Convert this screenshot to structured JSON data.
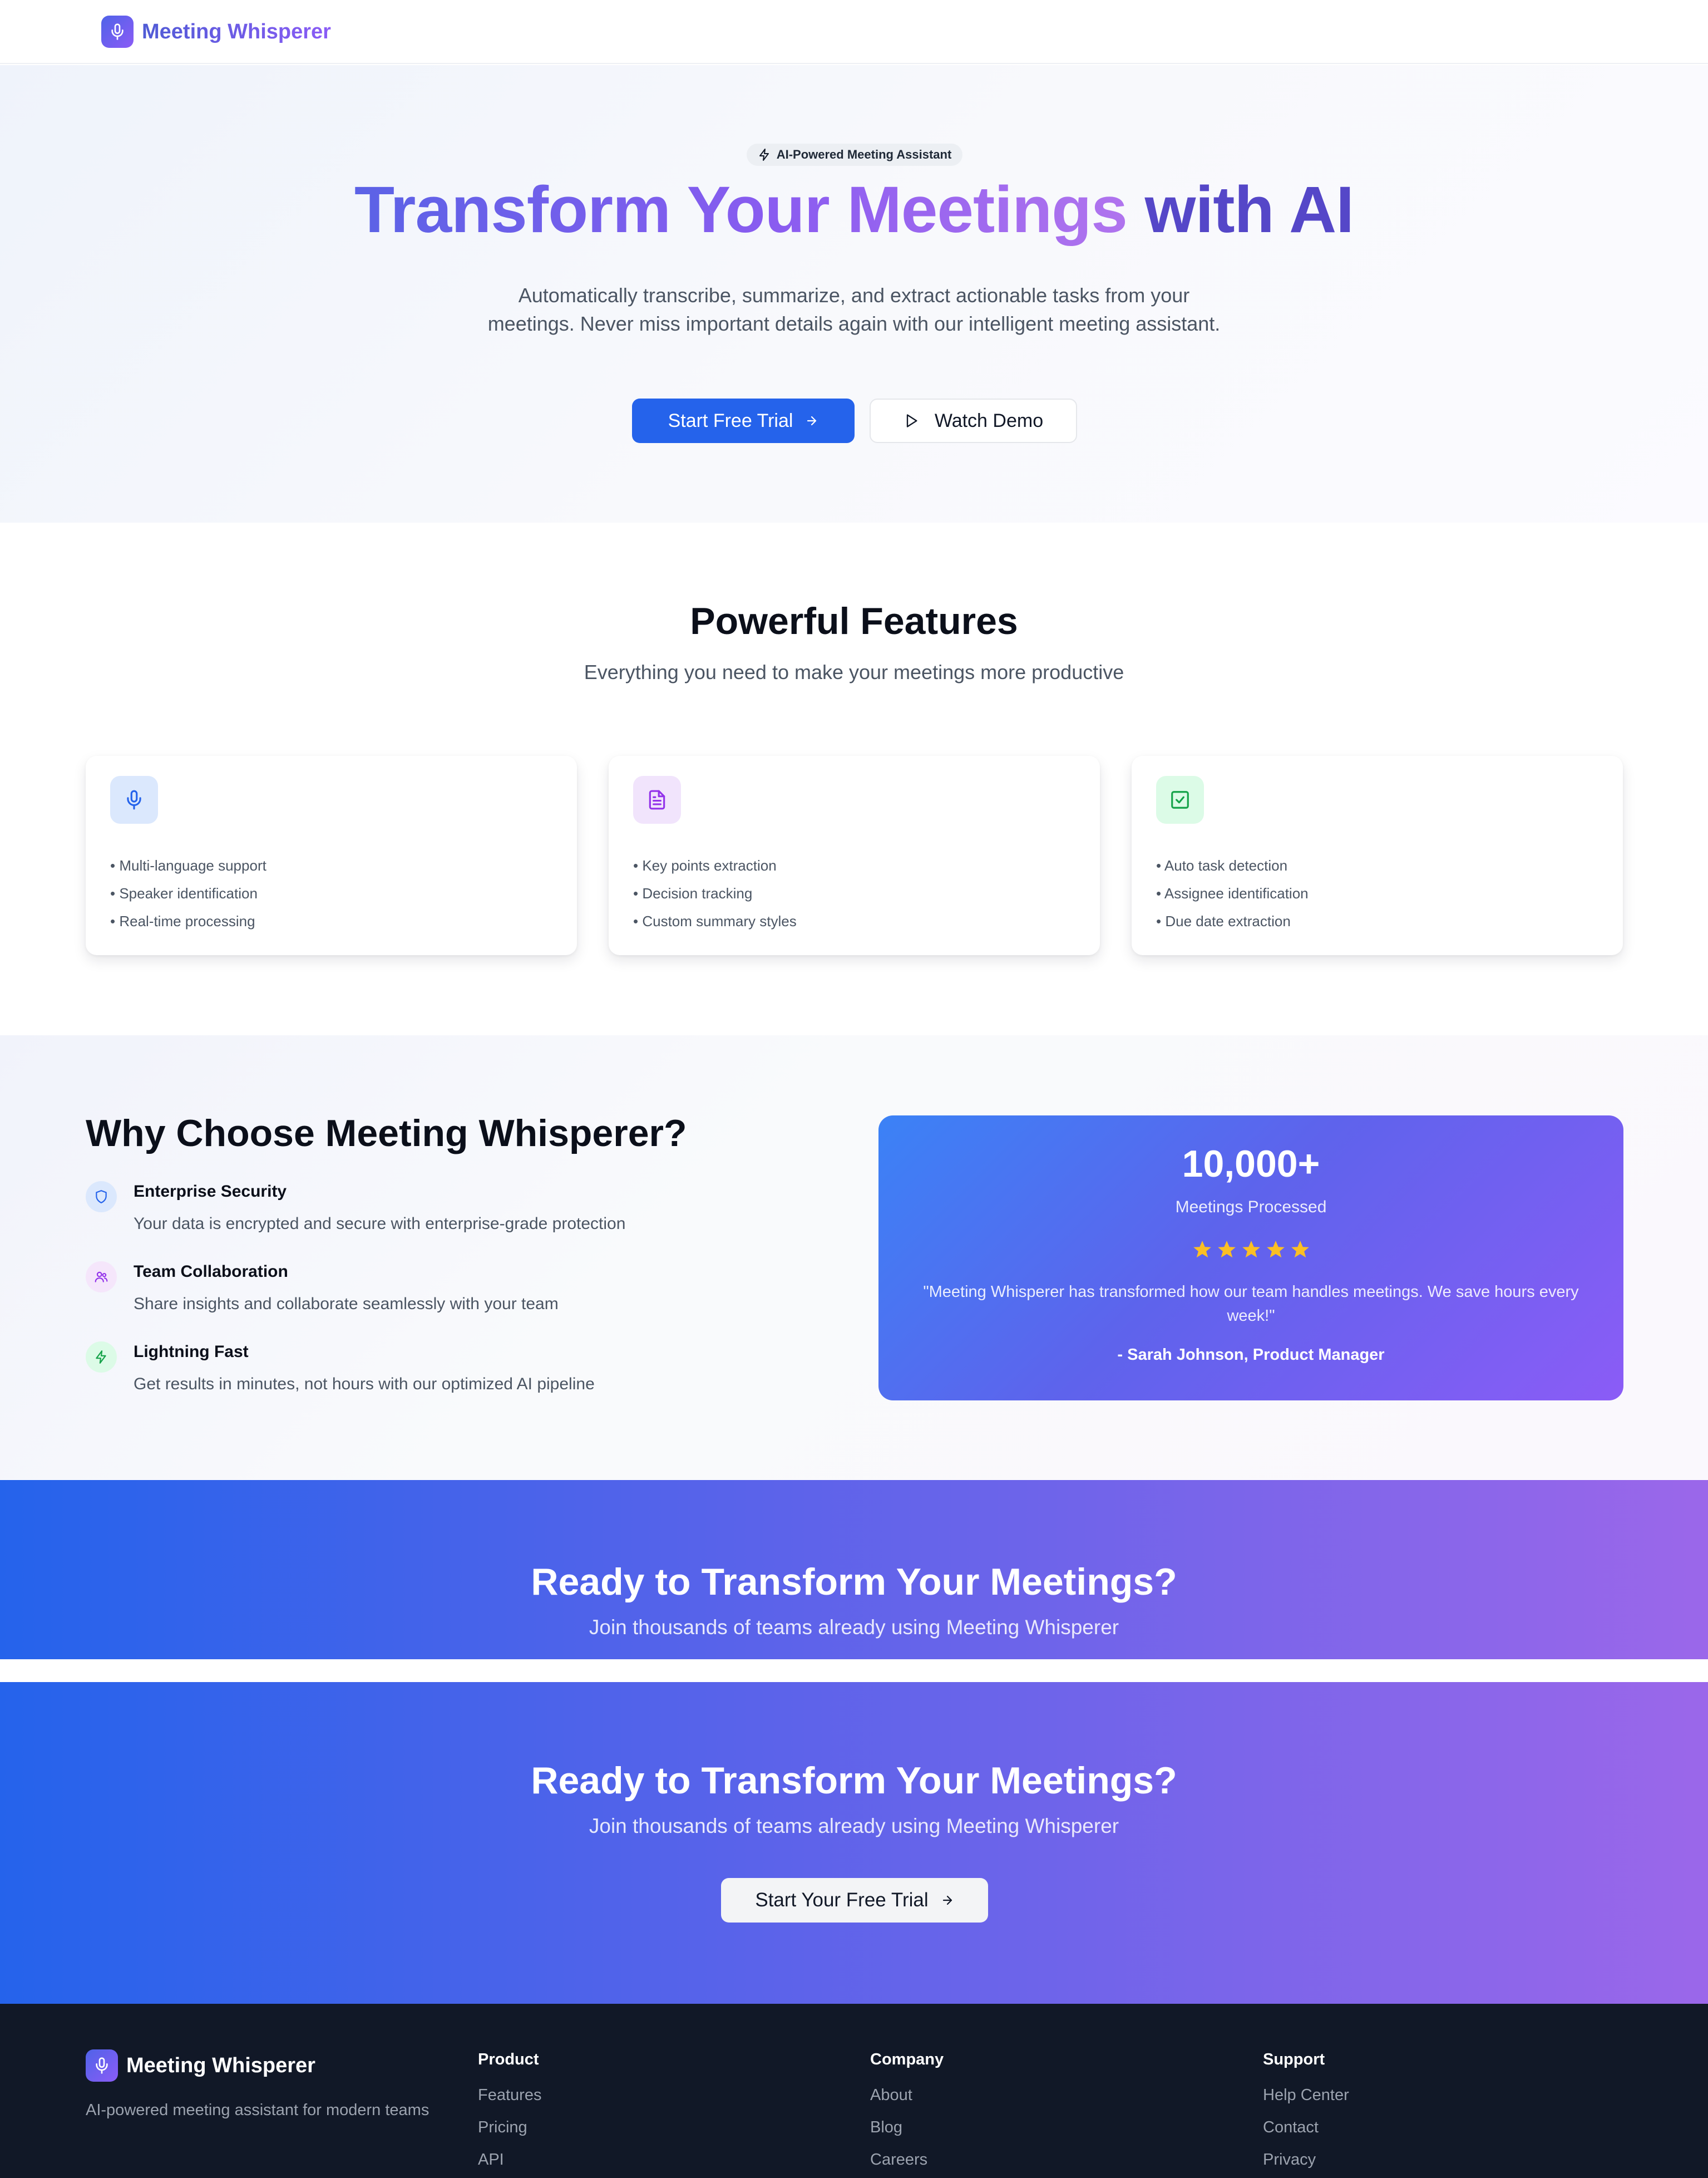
{
  "nav": {
    "brand": "Meeting Whisperer"
  },
  "hero": {
    "badge": "AI-Powered Meeting Assistant",
    "title_part1": "Transform Your Meetings",
    "title_part2": "with AI",
    "subtitle": "Automatically transcribe, summarize, and extract actionable tasks from your meetings. Never miss important details again with our intelligent meeting assistant.",
    "primary_button": "Start Free Trial",
    "secondary_button": "Watch Demo"
  },
  "features": {
    "title": "Powerful Features",
    "subtitle": "Everything you need to make your meetings more productive",
    "cards": [
      {
        "icon": "microphone-icon",
        "bullets": [
          "• Multi-language support",
          "• Speaker identification",
          "• Real-time processing"
        ]
      },
      {
        "icon": "document-icon",
        "bullets": [
          "• Key points extraction",
          "• Decision tracking",
          "• Custom summary styles"
        ]
      },
      {
        "icon": "check-square-icon",
        "bullets": [
          "• Auto task detection",
          "• Assignee identification",
          "• Due date extraction"
        ]
      }
    ]
  },
  "why": {
    "title": "Why Choose Meeting Whisperer?",
    "items": [
      {
        "icon": "shield-icon",
        "heading": "Enterprise Security",
        "text": "Your data is encrypted and secure with enterprise-grade protection"
      },
      {
        "icon": "users-icon",
        "heading": "Team Collaboration",
        "text": "Share insights and collaborate seamlessly with your team"
      },
      {
        "icon": "lightning-icon",
        "heading": "Lightning Fast",
        "text": "Get results in minutes, not hours with our optimized AI pipeline"
      }
    ],
    "stat": {
      "number": "10,000+",
      "label": "Meetings Processed",
      "rating": 5,
      "quote": "\"Meeting Whisperer has transformed how our team handles meetings. We save hours every week!\"",
      "author": "- Sarah Johnson, Product Manager"
    }
  },
  "cta1": {
    "title": "Ready to Transform Your Meetings?",
    "subtitle": "Join thousands of teams already using Meeting Whisperer"
  },
  "cta2": {
    "title": "Ready to Transform Your Meetings?",
    "subtitle": "Join thousands of teams already using Meeting Whisperer",
    "button": "Start Your Free Trial"
  },
  "footer": {
    "brand": "Meeting Whisperer",
    "description": "AI-powered meeting assistant for modern teams",
    "columns": [
      {
        "heading": "Product",
        "links": [
          "Features",
          "Pricing",
          "API"
        ]
      },
      {
        "heading": "Company",
        "links": [
          "About",
          "Blog",
          "Careers"
        ]
      },
      {
        "heading": "Support",
        "links": [
          "Help Center",
          "Contact",
          "Privacy"
        ]
      }
    ]
  },
  "colors": {
    "primary": "#2563eb",
    "accent_purple": "#8b5cf6",
    "footer_bg": "#111827",
    "star": "#fbbf24"
  }
}
